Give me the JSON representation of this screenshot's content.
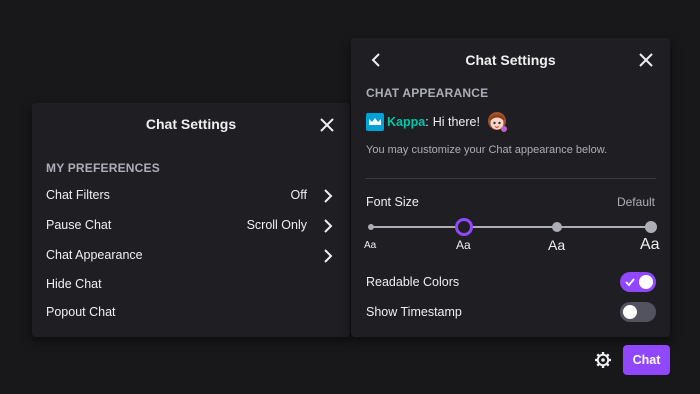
{
  "left_panel": {
    "title": "Chat Settings",
    "section": "MY PREFERENCES",
    "items": [
      {
        "label": "Chat Filters",
        "value": "Off"
      },
      {
        "label": "Pause Chat",
        "value": "Scroll Only"
      },
      {
        "label": "Chat Appearance",
        "value": ""
      },
      {
        "label": "Hide Chat",
        "value": ""
      },
      {
        "label": "Popout Chat",
        "value": ""
      }
    ]
  },
  "right_panel": {
    "title": "Chat Settings",
    "section": "CHAT APPEARANCE",
    "preview": {
      "username": "Kappa",
      "message": "Hi there!",
      "username_color": "#00c7ac",
      "emote": "kawaii-girl-emote"
    },
    "description": "You may customize your Chat appearance below.",
    "font_size": {
      "label": "Font Size",
      "current_value": "Default",
      "options": [
        "Aa",
        "Aa",
        "Aa",
        "Aa"
      ],
      "selected_index": 1
    },
    "toggles": [
      {
        "label": "Readable Colors",
        "on": true
      },
      {
        "label": "Show Timestamp",
        "on": false
      }
    ]
  },
  "bottom_bar": {
    "chat_button": "Chat"
  },
  "colors": {
    "accent": "#9147ff",
    "background": "#18181b",
    "panel": "#1f1f23"
  }
}
